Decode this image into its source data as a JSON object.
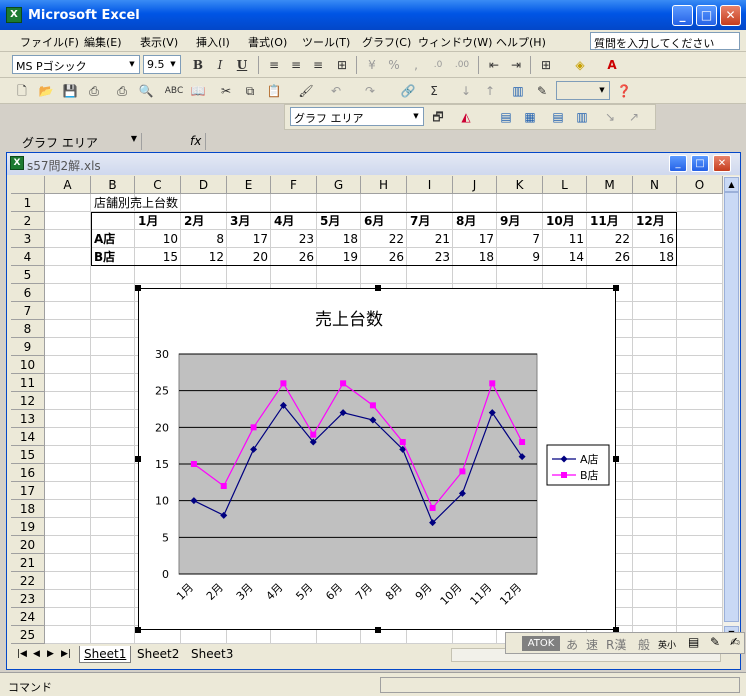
{
  "window": {
    "title": "Microsoft Excel"
  },
  "menu": {
    "items": [
      "ファイル(F)",
      "編集(E)",
      "表示(V)",
      "挿入(I)",
      "書式(O)",
      "ツール(T)",
      "グラフ(C)",
      "ウィンドウ(W)",
      "ヘルプ(H)"
    ],
    "help_placeholder": "質問を入力してください"
  },
  "format_toolbar": {
    "font": "MS Pゴシック",
    "size": "9.5",
    "bold": "B",
    "italic": "I",
    "underline": "U"
  },
  "chart_toolbar": {
    "object": "グラフ エリア"
  },
  "formula_bar": {
    "name_box": "グラフ エリア",
    "fx": "fx",
    "content": ""
  },
  "document": {
    "title": "s57問2解.xls"
  },
  "sheet": {
    "columns": [
      "A",
      "B",
      "C",
      "D",
      "E",
      "F",
      "G",
      "H",
      "I",
      "J",
      "K",
      "L",
      "M",
      "N",
      "O"
    ],
    "rows": [
      "1",
      "2",
      "3",
      "4",
      "5",
      "6",
      "7",
      "8",
      "9",
      "10",
      "11",
      "12",
      "13",
      "14",
      "15",
      "16",
      "17",
      "18",
      "19",
      "20",
      "21",
      "22",
      "23",
      "24",
      "25"
    ],
    "title_cell": "店舗別売上台数",
    "months": [
      "1月",
      "2月",
      "3月",
      "4月",
      "5月",
      "6月",
      "7月",
      "8月",
      "9月",
      "10月",
      "11月",
      "12月"
    ],
    "store_a": {
      "label": "A店",
      "values": [
        "10",
        "8",
        "17",
        "23",
        "18",
        "22",
        "21",
        "17",
        "7",
        "11",
        "22",
        "16"
      ]
    },
    "store_b": {
      "label": "B店",
      "values": [
        "15",
        "12",
        "20",
        "26",
        "19",
        "26",
        "23",
        "18",
        "9",
        "14",
        "26",
        "18"
      ]
    }
  },
  "sheet_tabs": [
    "Sheet1",
    "Sheet2",
    "Sheet3"
  ],
  "status": {
    "text": "コマンド"
  },
  "ime": {
    "items": [
      "ATOK",
      "あ",
      "速",
      "R漢",
      "般",
      "英小"
    ]
  },
  "chart_data": {
    "type": "line",
    "title": "売上台数",
    "categories": [
      "1月",
      "2月",
      "3月",
      "4月",
      "5月",
      "6月",
      "7月",
      "8月",
      "9月",
      "10月",
      "11月",
      "12月"
    ],
    "series": [
      {
        "name": "A店",
        "values": [
          10,
          8,
          17,
          23,
          18,
          22,
          21,
          17,
          7,
          11,
          22,
          16
        ],
        "color": "#000080"
      },
      {
        "name": "B店",
        "values": [
          15,
          12,
          20,
          26,
          19,
          26,
          23,
          18,
          9,
          14,
          26,
          18
        ],
        "color": "#ff00ff"
      }
    ],
    "ylim": [
      0,
      30
    ],
    "yticks": [
      "0",
      "5",
      "10",
      "15",
      "20",
      "25",
      "30"
    ],
    "grid": true,
    "plot_background": "#c0c0c0",
    "legend": "right"
  }
}
